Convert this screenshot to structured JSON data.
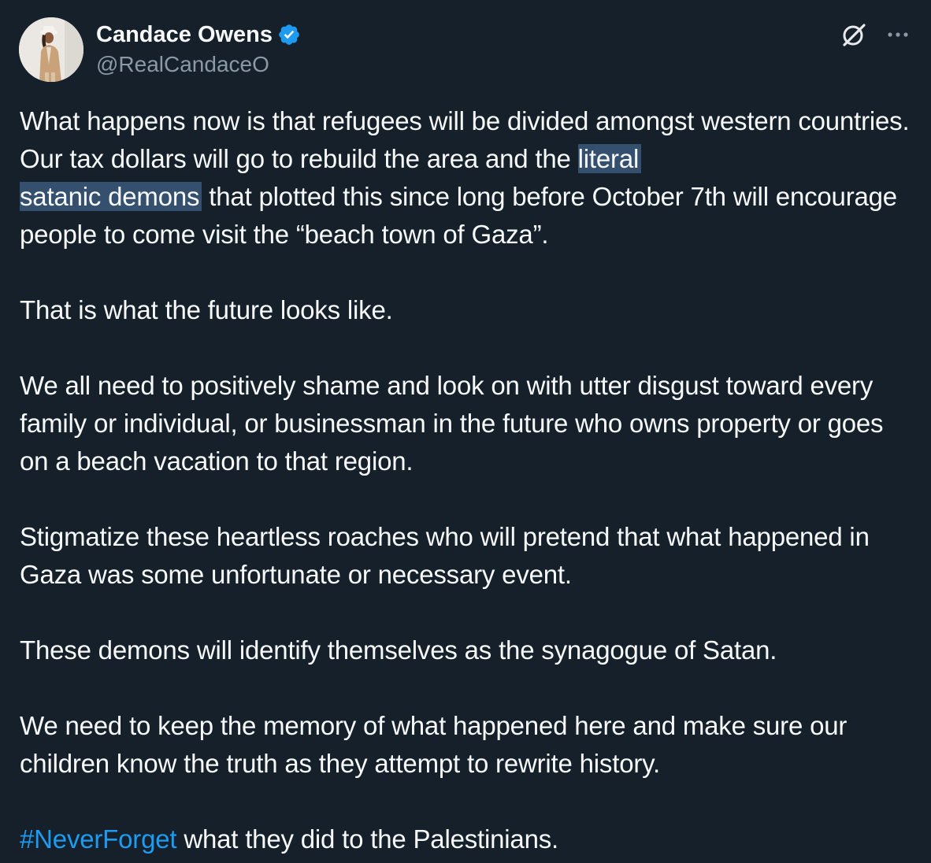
{
  "author": {
    "display_name": "Candace Owens",
    "handle": "@RealCandaceO",
    "verified": true,
    "avatar_icon": "profile-photo"
  },
  "actions": {
    "grok_icon": "grok-icon",
    "more_icon": "more-options-icon"
  },
  "tweet": {
    "p1_a": "What happens now is that refugees will be divided amongst western countries. Our tax dollars will go to rebuild the area and the ",
    "p1_hl1": "literal ",
    "p1_hl2": "satanic demons",
    "p1_b": " that plotted this since long before October 7th will encourage people to come visit the “beach town of Gaza”.",
    "p2": "That is what the future looks like.",
    "p3": "We all need to positively shame and look on with utter disgust toward every family or individual, or businessman in the future who owns property or goes on a beach vacation to that region.",
    "p4": "Stigmatize these heartless roaches who will pretend that what happened in Gaza was some unfortunate or necessary event.",
    "p5": "These demons will identify themselves as the synagogue of Satan.",
    "p6": "We need to keep the memory of what happened here and make sure our children know the truth as they attempt to rewrite history.",
    "p7_hashtag": "#NeverForget",
    "p7_rest": " what they did to the Palestinians."
  },
  "colors": {
    "background": "#15202b",
    "text": "#f7f9f9",
    "secondary_text": "#8b98a5",
    "link": "#1d9bf0",
    "verified_badge": "#1d9bf0",
    "selection_highlight": "#35506f"
  }
}
